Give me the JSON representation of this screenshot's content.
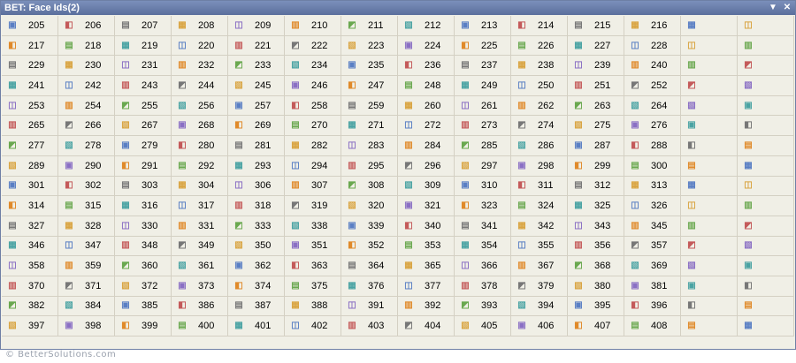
{
  "window": {
    "title": "BET: Face Ids(2)",
    "dropdown_icon": "dropdown-arrow-icon",
    "close_icon": "close-icon"
  },
  "rows": [
    [
      "205",
      "206",
      "207",
      "208",
      "209",
      "210",
      "211",
      "212",
      "213",
      "214",
      "215",
      "216"
    ],
    [
      "217",
      "218",
      "219",
      "220",
      "221",
      "222",
      "223",
      "224",
      "225",
      "226",
      "227",
      "228"
    ],
    [
      "229",
      "230",
      "231",
      "232",
      "233",
      "234",
      "235",
      "236",
      "237",
      "238",
      "239",
      "240"
    ],
    [
      "241",
      "242",
      "243",
      "244",
      "245",
      "246",
      "247",
      "248",
      "249",
      "250",
      "251",
      "252"
    ],
    [
      "253",
      "254",
      "255",
      "256",
      "257",
      "258",
      "259",
      "260",
      "261",
      "262",
      "263",
      "264"
    ],
    [
      "265",
      "266",
      "267",
      "268",
      "269",
      "270",
      "271",
      "272",
      "273",
      "274",
      "275",
      "276"
    ],
    [
      "277",
      "278",
      "279",
      "280",
      "281",
      "282",
      "283",
      "284",
      "285",
      "286",
      "287",
      "288"
    ],
    [
      "289",
      "290",
      "291",
      "292",
      "293",
      "294",
      "295",
      "296",
      "297",
      "298",
      "299",
      "300"
    ],
    [
      "301",
      "302",
      "303",
      "304",
      "306",
      "307",
      "308",
      "309",
      "310",
      "311",
      "312",
      "313"
    ],
    [
      "314",
      "315",
      "316",
      "317",
      "318",
      "319",
      "320",
      "321",
      "323",
      "324",
      "325",
      "326"
    ],
    [
      "327",
      "328",
      "330",
      "331",
      "333",
      "338",
      "339",
      "340",
      "341",
      "342",
      "343",
      "345"
    ],
    [
      "346",
      "347",
      "348",
      "349",
      "350",
      "351",
      "352",
      "353",
      "354",
      "355",
      "356",
      "357"
    ],
    [
      "358",
      "359",
      "360",
      "361",
      "362",
      "363",
      "364",
      "365",
      "366",
      "367",
      "368",
      "369"
    ],
    [
      "370",
      "371",
      "372",
      "373",
      "374",
      "375",
      "376",
      "377",
      "378",
      "379",
      "380",
      "381"
    ],
    [
      "382",
      "384",
      "385",
      "386",
      "387",
      "388",
      "391",
      "392",
      "393",
      "394",
      "395",
      "396"
    ],
    [
      "397",
      "398",
      "399",
      "400",
      "401",
      "402",
      "403",
      "404",
      "405",
      "406",
      "407",
      "408"
    ]
  ],
  "watermark": "© BetterSolutions.com",
  "colors": {
    "title_bg": "#6b7fac",
    "window_bg": "#f0efe6",
    "grid_line": "#d4d0c3"
  }
}
